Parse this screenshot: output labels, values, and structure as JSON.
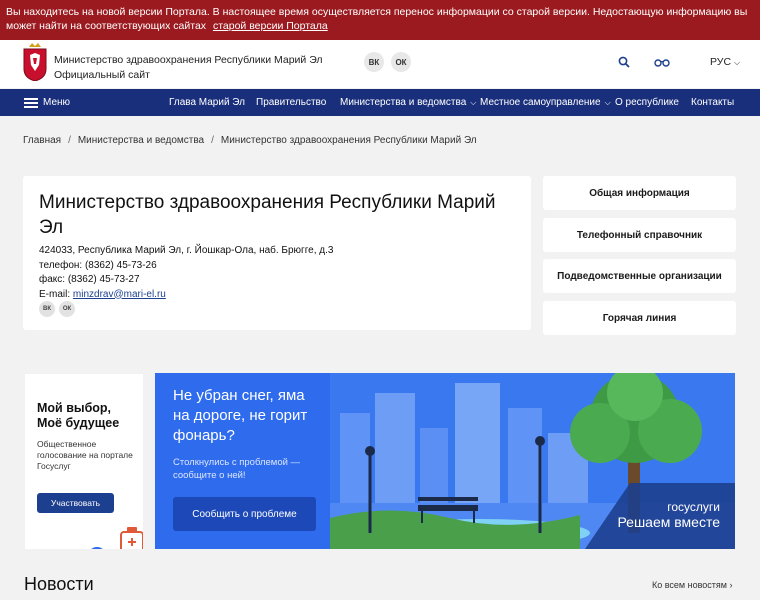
{
  "notice": {
    "text": "Вы находитесь на новой версии Портала. В настоящее время осуществляется перенос информации со старой версии. Недостающую информацию вы может найти на соответствующих сайтах",
    "link": "старой версии Портала"
  },
  "header": {
    "title": "Министерство здравоохранения Республики Марий Эл",
    "subtitle": "Официальный сайт",
    "social": [
      "ВК",
      "ОК"
    ],
    "language": "РУС"
  },
  "nav": {
    "menu": "Меню",
    "items": [
      "Глава Марий Эл",
      "Правительство",
      "Министерства и ведомства",
      "Местное самоуправление",
      "О республике",
      "Контакты"
    ]
  },
  "breadcrumb": [
    "Главная",
    "Министерства и ведомства",
    "Министерство здравоохранения Республики Марий Эл"
  ],
  "org": {
    "title": "Министерство здравоохранения Республики Марий Эл",
    "address": "424033, Республика Марий Эл, г. Йошкар-Ола, наб. Брюгге, д.3",
    "phone": "телефон: (8362) 45-73-26",
    "fax": "факс: (8362) 45-73-27",
    "email_label": "E-mail:",
    "email": "minzdrav@mari-el.ru"
  },
  "side_links": [
    "Общая информация",
    "Телефонный справочник",
    "Подведомственные организации",
    "Горячая линия"
  ],
  "vote": {
    "title1": "Мой выбор,",
    "title2": "Моё будущее",
    "desc1": "Общественное",
    "desc2": "голосование на портале",
    "desc3": "Госуслуг",
    "button": "Участвовать"
  },
  "banner": {
    "q1": "Не убран снег, яма",
    "q2": "на дороге, не горит",
    "q3": "фонарь?",
    "s1": "Столкнулись с проблемой —",
    "s2": "сообщите о ней!",
    "button": "Сообщить о проблеме",
    "brand": "госуслуги",
    "slogan": "Решаем вместе"
  },
  "news": {
    "title": "Новости",
    "all": "Ко всем новостям"
  },
  "colors": {
    "notice": "#9b1a1f",
    "nav": "#1a2f7c",
    "accent": "#1d3f8f",
    "banner": "#2f6bed"
  }
}
